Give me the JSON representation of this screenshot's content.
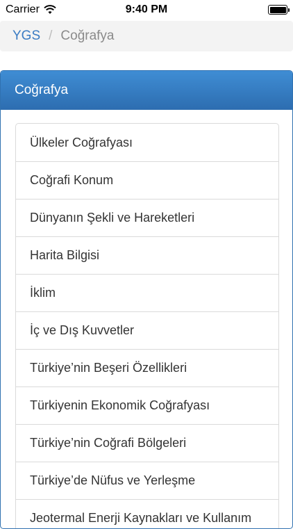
{
  "status_bar": {
    "carrier": "Carrier",
    "time": "9:40 PM"
  },
  "breadcrumb": {
    "root": "YGS",
    "separator": "/",
    "current": "Coğrafya"
  },
  "panel": {
    "title": "Coğrafya",
    "items": [
      "Ülkeler Coğrafyası",
      "Coğrafi Konum",
      "Dünyanın Şekli ve Hareketleri",
      "Harita Bilgisi",
      "İklim",
      "İç ve Dış Kuvvetler",
      "Türkiye’nin Beşeri Özellikleri",
      "Türkiyenin Ekonomik Coğrafyası",
      "Türkiye’nin Coğrafi Bölgeleri",
      "Türkiye’de Nüfus ve Yerleşme",
      "Jeotermal Enerji Kaynakları ve Kullanım"
    ]
  }
}
